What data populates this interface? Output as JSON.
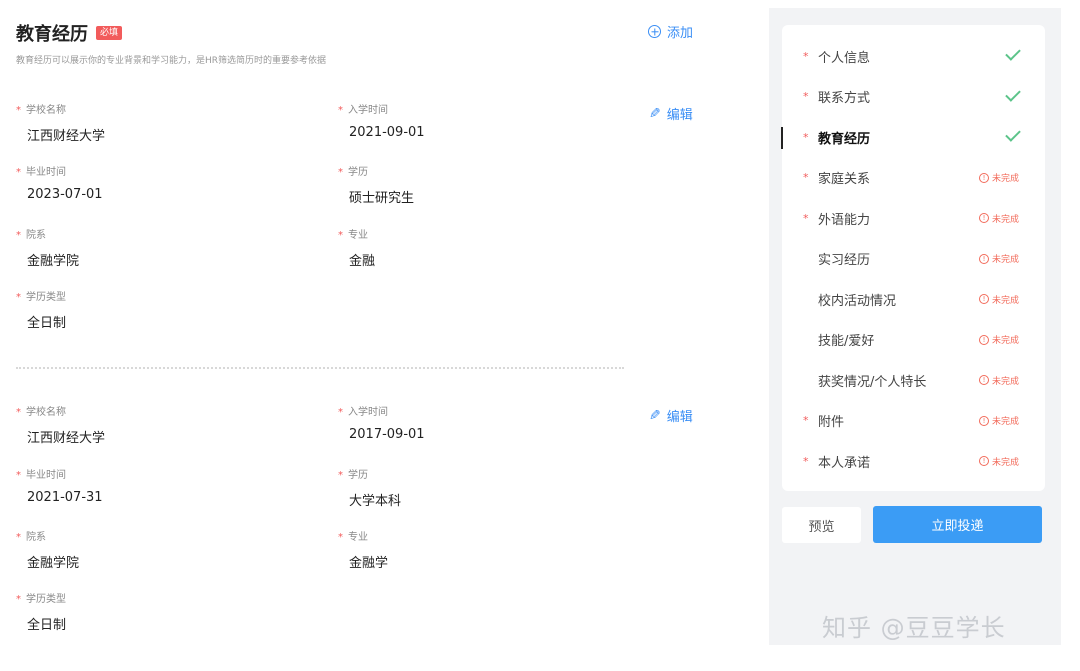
{
  "section": {
    "title": "教育经历",
    "badge": "必填",
    "description": "教育经历可以展示你的专业背景和学习能力，是HR筛选简历时的重要参考依据",
    "add_label": "添加",
    "edit_label": "编辑"
  },
  "entries": [
    {
      "school_label": "学校名称",
      "school": "江西财经大学",
      "enroll_label": "入学时间",
      "enroll": "2021-09-01",
      "grad_label": "毕业时间",
      "grad": "2023-07-01",
      "degree_label": "学历",
      "degree": "硕士研究生",
      "dept_label": "院系",
      "dept": "金融学院",
      "major_label": "专业",
      "major": "金融",
      "type_label": "学历类型",
      "type": "全日制"
    },
    {
      "school_label": "学校名称",
      "school": "江西财经大学",
      "enroll_label": "入学时间",
      "enroll": "2017-09-01",
      "grad_label": "毕业时间",
      "grad": "2021-07-31",
      "degree_label": "学历",
      "degree": "大学本科",
      "dept_label": "院系",
      "dept": "金融学院",
      "major_label": "专业",
      "major": "金融学",
      "type_label": "学历类型",
      "type": "全日制"
    }
  ],
  "sidebar": {
    "incomplete_text": "未完成",
    "items": [
      {
        "label": "个人信息",
        "required": true,
        "done": true
      },
      {
        "label": "联系方式",
        "required": true,
        "done": true
      },
      {
        "label": "教育经历",
        "required": true,
        "done": true,
        "active": true
      },
      {
        "label": "家庭关系",
        "required": true,
        "done": false
      },
      {
        "label": "外语能力",
        "required": true,
        "done": false
      },
      {
        "label": "实习经历",
        "required": false,
        "done": false
      },
      {
        "label": "校内活动情况",
        "required": false,
        "done": false
      },
      {
        "label": "技能/爱好",
        "required": false,
        "done": false
      },
      {
        "label": "获奖情况/个人特长",
        "required": false,
        "done": false
      },
      {
        "label": "附件",
        "required": true,
        "done": false
      },
      {
        "label": "本人承诺",
        "required": true,
        "done": false
      }
    ],
    "preview_label": "预览",
    "submit_label": "立即投递"
  },
  "watermark": "知乎 @豆豆学长",
  "colors": {
    "accent": "#3a8ef5",
    "required": "#f25b5b",
    "done": "#5cc48a",
    "incomplete": "#f26b5b",
    "sidebar_bg": "#f2f3f5"
  }
}
